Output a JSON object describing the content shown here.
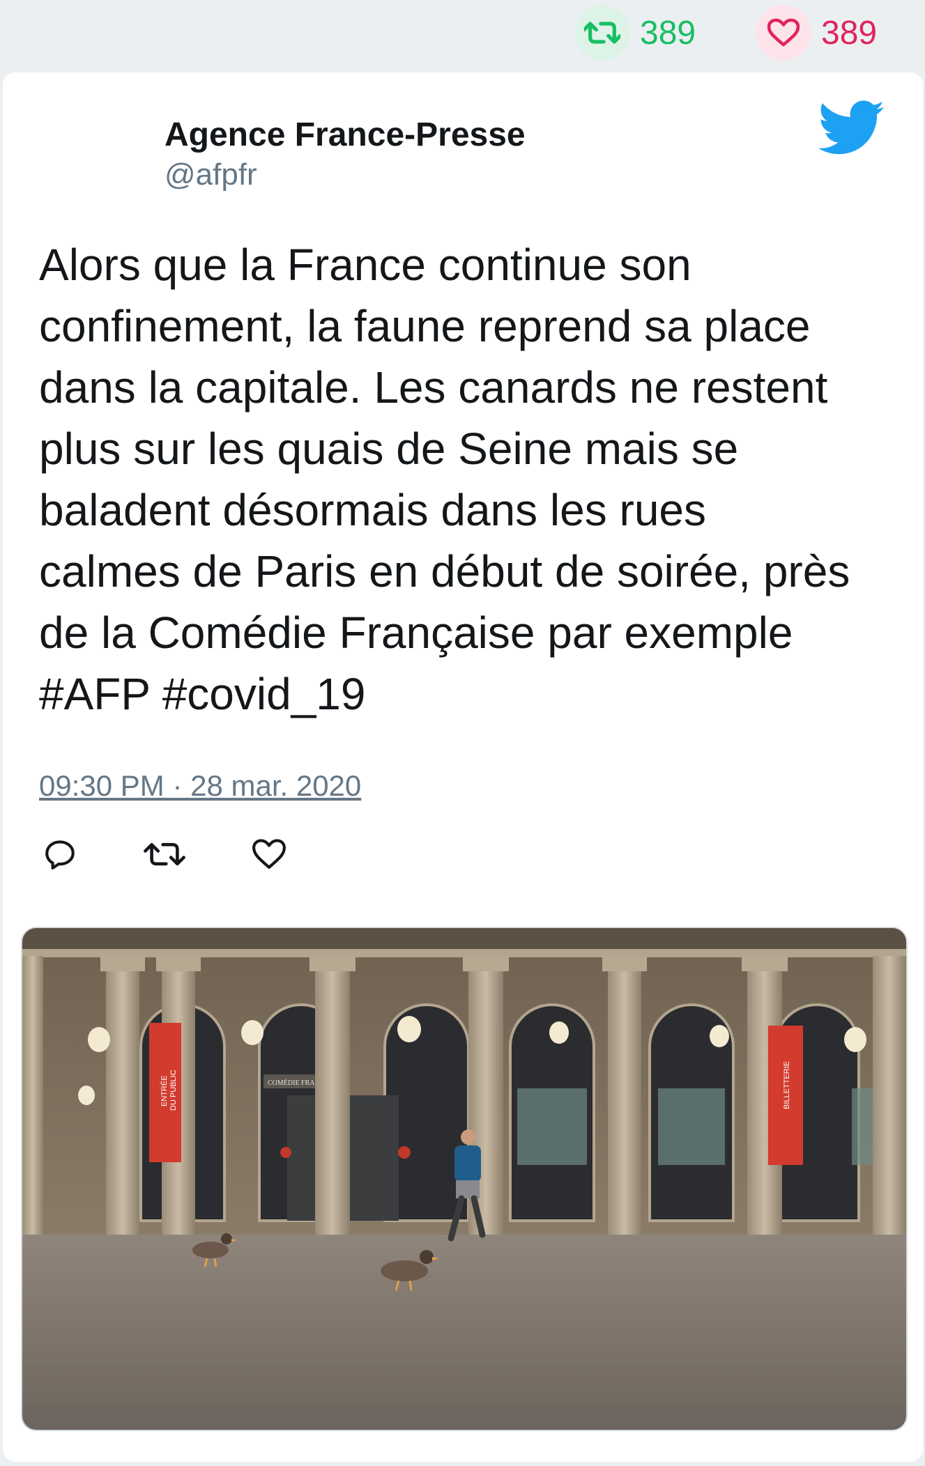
{
  "stats": {
    "retweets": "389",
    "likes": "389",
    "retweet_color": "#17bf63",
    "like_color": "#e0245e"
  },
  "tweet": {
    "author_name": "Agence France-Presse",
    "author_handle": "@afpfr",
    "text_lines": [
      "Alors que la France continue son",
      "confinement, la faune reprend sa place",
      "dans la capitale. Les canards ne restent",
      "plus sur les quais de Seine mais se",
      "baladent désormais dans les rues",
      "calmes de Paris en début de soirée, près",
      "de la Comédie Française par exemple",
      "#AFP #covid_19"
    ],
    "timestamp": "09:30 PM · 28 mar. 2020",
    "brand_icon": "twitter-bird-icon",
    "brand_color": "#1da1f2"
  },
  "actions": {
    "reply_icon": "reply-icon",
    "retweet_icon": "retweet-icon",
    "like_icon": "heart-icon"
  },
  "media": {
    "banner_left_lines": [
      "ENTRÉE",
      "DU PUBLIC"
    ],
    "banner_right": "BILLETTERIE",
    "sign_text": "COMÉDIE FRA"
  }
}
